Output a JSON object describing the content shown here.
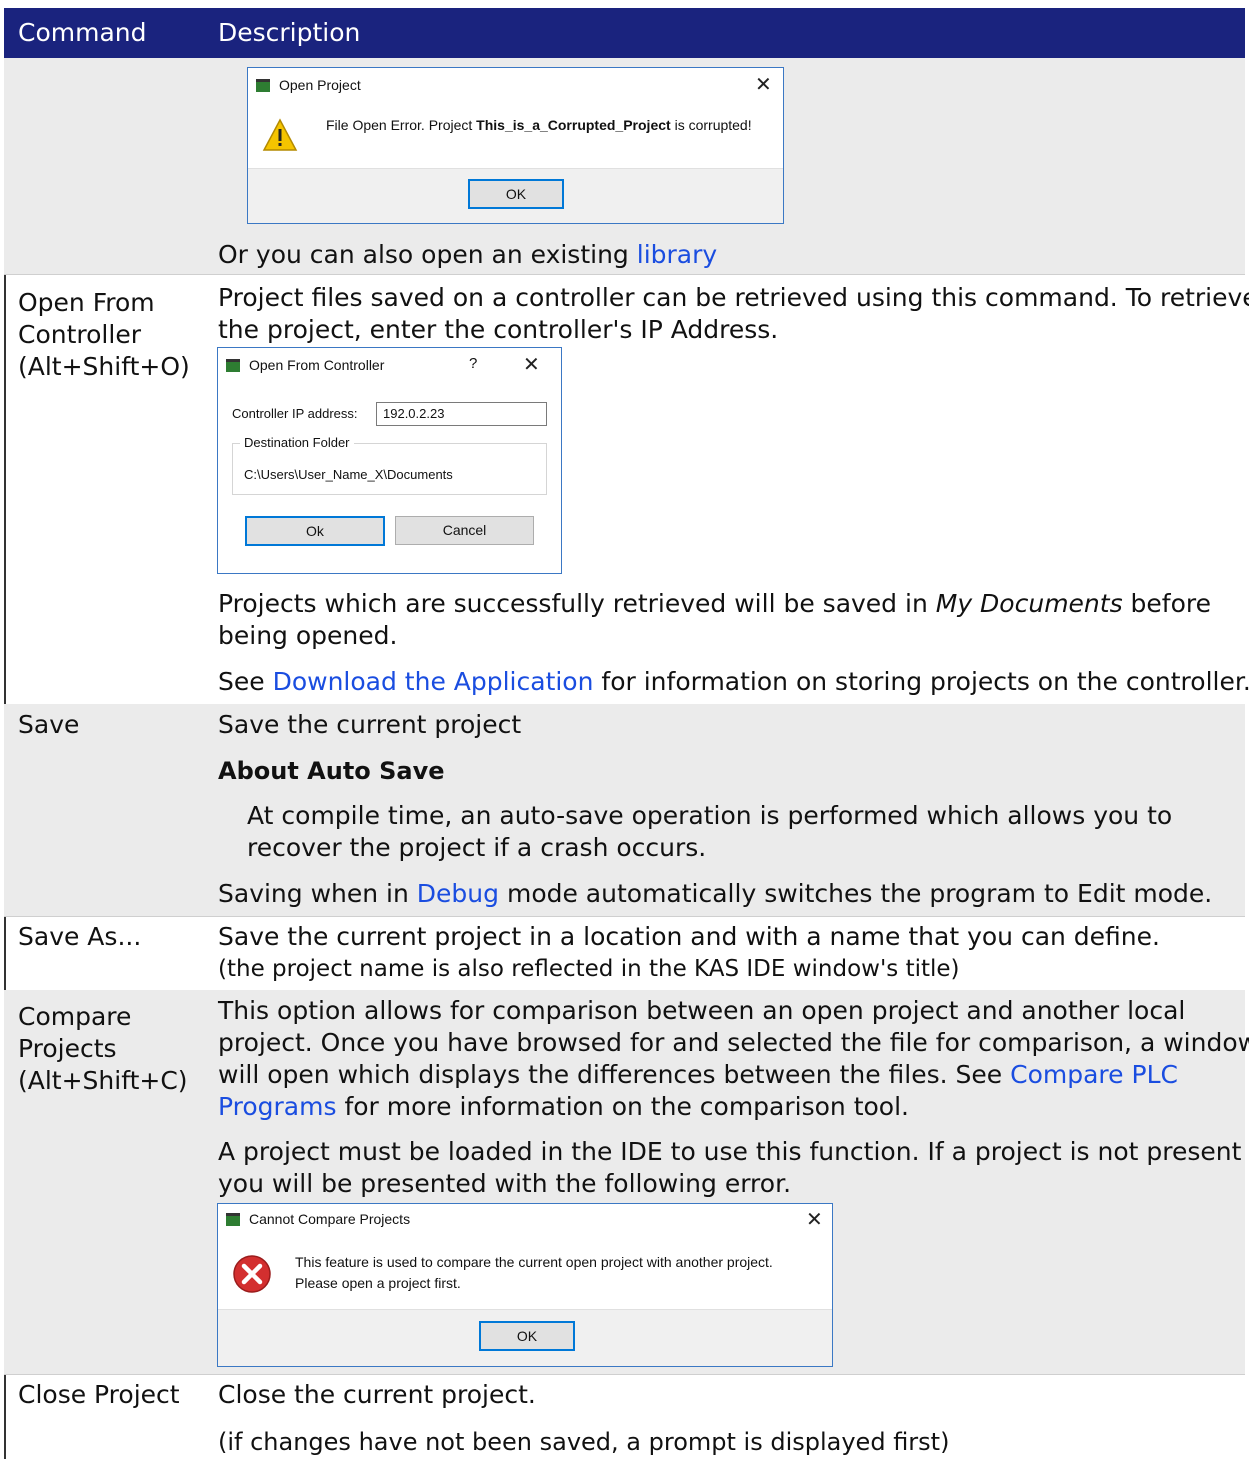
{
  "header": {
    "col_command": "Command",
    "col_description": "Description"
  },
  "row_open_tail": {
    "dialog": {
      "title": "Open Project",
      "msg_pre": "File Open Error. Project ",
      "msg_bold": "This_is_a_Corrupted_Project",
      "msg_post": " is corrupted!",
      "ok": "OK"
    },
    "text_pre": "Or you can also open an existing ",
    "link": "library"
  },
  "row_open_controller": {
    "command_lines": [
      "Open From",
      "Controller",
      "(Alt+Shift+O)"
    ],
    "desc_lines": [
      "Project files saved on a controller can be retrieved using this command. To retrieve",
      "the project, enter the controller's IP Address."
    ],
    "dialog": {
      "title": "Open From Controller",
      "help": "?",
      "ip_label": "Controller IP address:",
      "ip_value": "192.0.2.23",
      "dest_label": "Destination Folder",
      "dest_path": "C:\\Users\\User_Name_X\\Documents",
      "ok": "Ok",
      "cancel": "Cancel"
    },
    "saved_pre": "Projects which are successfully retrieved will be saved in ",
    "saved_em": "My Documents",
    "saved_post": " before",
    "saved_line2": "being opened.",
    "see_pre": "See ",
    "see_link": "Download the Application",
    "see_post": " for information on storing projects on the controller."
  },
  "row_save": {
    "command": "Save",
    "desc": "Save the current project",
    "note_title": "About Auto Save",
    "note_lines": [
      "At compile time, an auto-save operation is performed which allows you to",
      "recover the project if a crash occurs."
    ],
    "debug_pre": "Saving when in ",
    "debug_link": "Debug",
    "debug_post": " mode automatically switches the program to Edit mode."
  },
  "row_save_as": {
    "command": "Save As...",
    "desc_lines": [
      "Save the current project in a location and with a name that you can define.",
      "(the project name is also reflected in the KAS IDE window's title)"
    ]
  },
  "row_compare": {
    "command_lines": [
      "Compare",
      "Projects",
      "(Alt+Shift+C)"
    ],
    "desc_lines": [
      "This option allows for comparison between an open project and another local",
      "project. Once you have browsed for and selected the file for comparison, a window",
      "will open which displays the differences between the files. See "
    ],
    "link_a": "Compare PLC",
    "link_b": "Programs",
    "desc_end": " for more information on the comparison tool.",
    "note_lines": [
      "A project must be loaded in the IDE to use this function. If a project is not present",
      "you will be presented with the following error."
    ],
    "dialog": {
      "title": "Cannot Compare Projects",
      "msg1": "This feature is used to compare the current open project with another project.",
      "msg2": "Please open a project first.",
      "ok": "OK"
    }
  },
  "row_close": {
    "command": "Close Project",
    "desc": "Close the current project.",
    "note": "(if changes have not been saved, a prompt is displayed first)"
  }
}
